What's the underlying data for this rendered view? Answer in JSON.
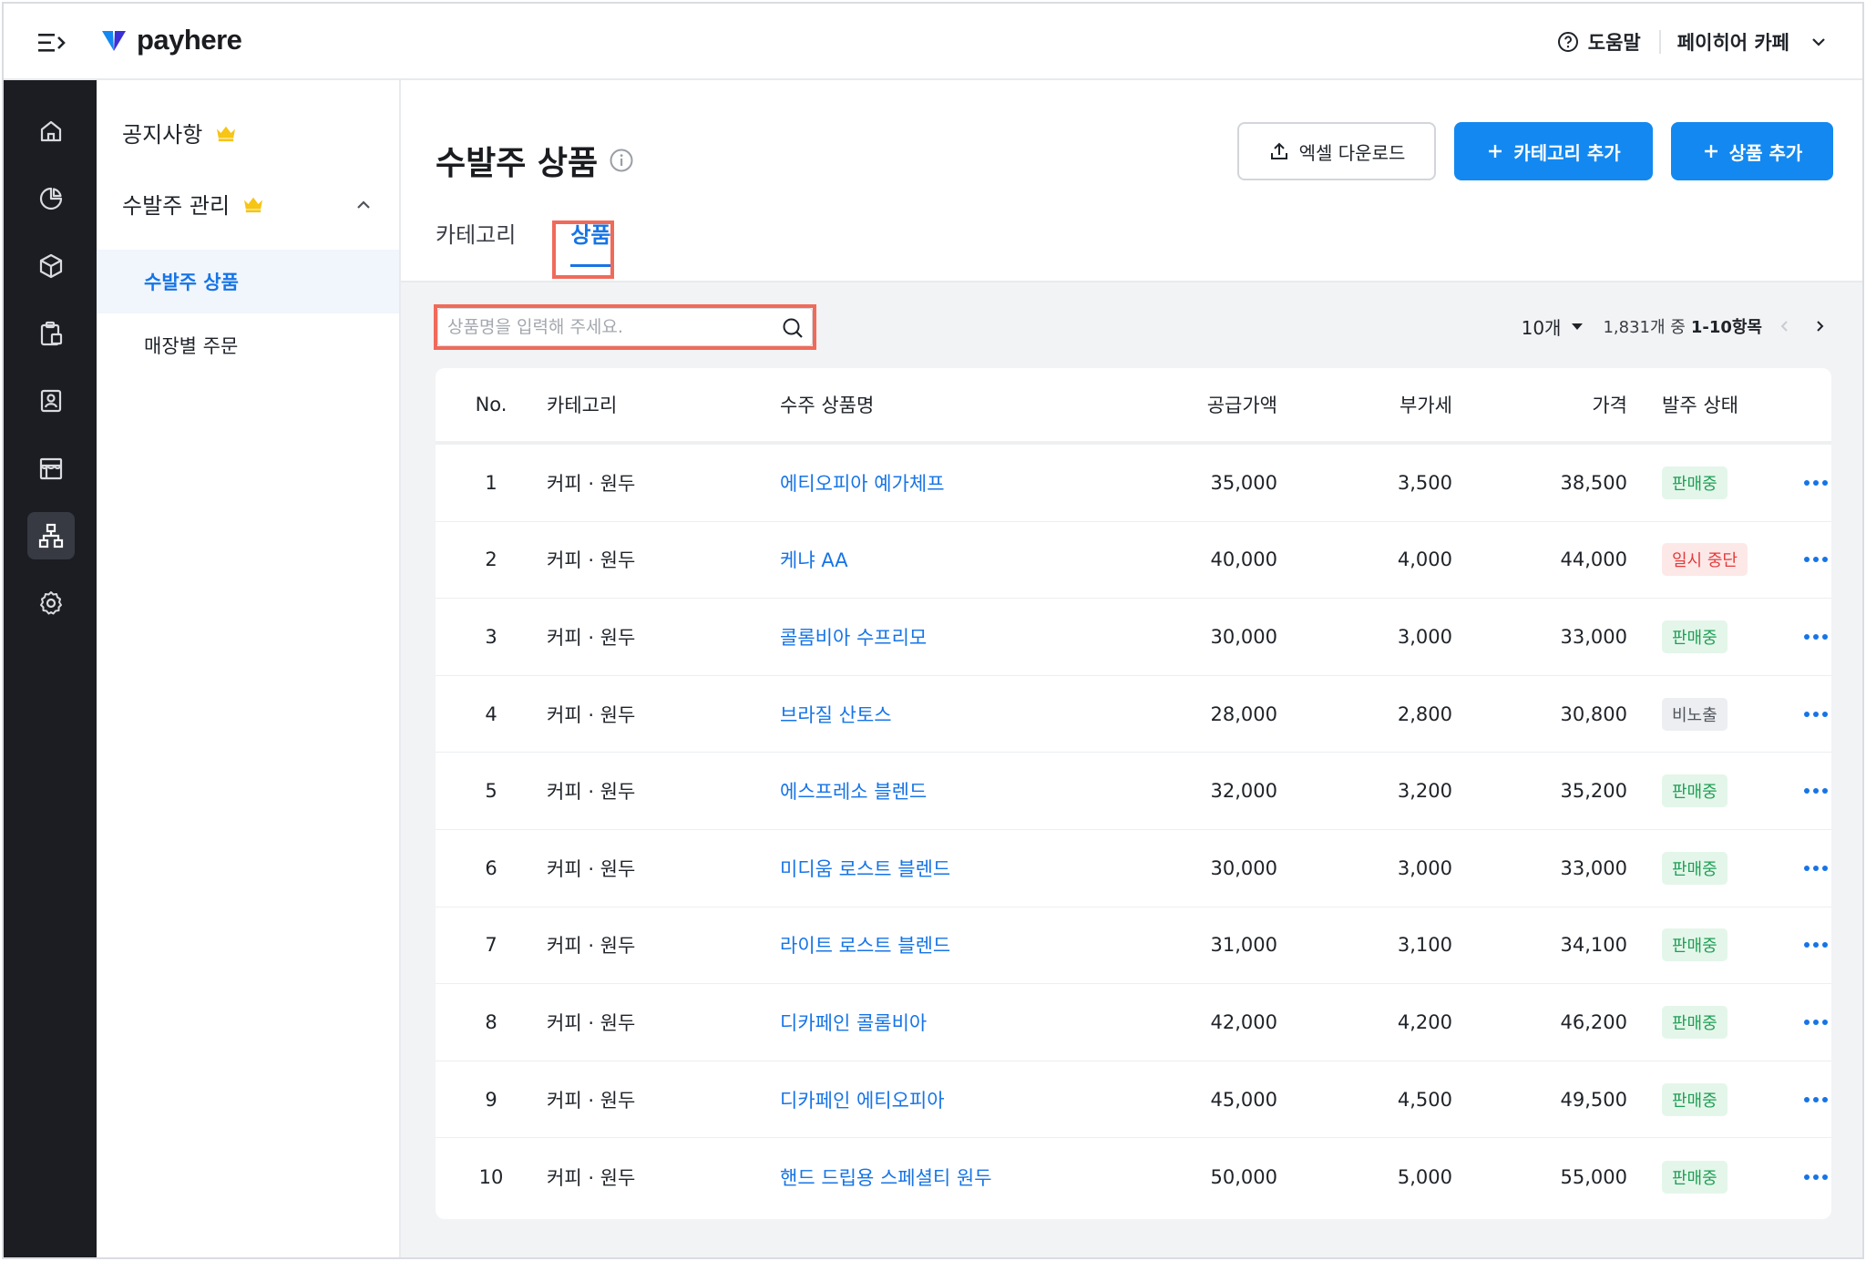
{
  "app": {
    "logo_text": "payhere",
    "brand_color": "#1388f0"
  },
  "topbar": {
    "help_label": "도움말",
    "store_label": "페이히어 카페"
  },
  "iconbar": {
    "items": [
      "home-icon",
      "chart-pie-icon",
      "box-icon",
      "clipboard-icon",
      "contact-card-icon",
      "store-icon",
      "org-chart-icon",
      "settings-icon"
    ],
    "active": "org-chart-icon"
  },
  "subnav": {
    "notice_label": "공지사항",
    "order_mgmt_label": "수발주 관리",
    "items": [
      {
        "label": "수발주 상품",
        "active": true
      },
      {
        "label": "매장별 주문",
        "active": false
      }
    ]
  },
  "page": {
    "title": "수발주 상품",
    "excel_label": "엑셀 다운로드",
    "add_category_label": "카테고리 추가",
    "add_product_label": "상품 추가",
    "tabs": [
      {
        "label": "카테고리",
        "active": false
      },
      {
        "label": "상품",
        "active": true
      }
    ]
  },
  "search": {
    "placeholder": "상품명을 입력해 주세요.",
    "value": ""
  },
  "pagination": {
    "per_page": "10개",
    "total_prefix": "1,831개 중",
    "range": "1-10항목"
  },
  "table": {
    "headers": {
      "no": "No.",
      "category": "카테고리",
      "name": "수주 상품명",
      "supply": "공급가액",
      "vat": "부가세",
      "price": "가격",
      "status": "발주 상태"
    },
    "rows": [
      {
        "no": "1",
        "category": "커피 · 원두",
        "name": "에티오피아 예가체프",
        "supply": "35,000",
        "vat": "3,500",
        "price": "38,500",
        "status": "판매중",
        "status_type": "green"
      },
      {
        "no": "2",
        "category": "커피 · 원두",
        "name": "케냐 AA",
        "supply": "40,000",
        "vat": "4,000",
        "price": "44,000",
        "status": "일시 중단",
        "status_type": "red"
      },
      {
        "no": "3",
        "category": "커피 · 원두",
        "name": "콜롬비아 수프리모",
        "supply": "30,000",
        "vat": "3,000",
        "price": "33,000",
        "status": "판매중",
        "status_type": "green"
      },
      {
        "no": "4",
        "category": "커피 · 원두",
        "name": "브라질 산토스",
        "supply": "28,000",
        "vat": "2,800",
        "price": "30,800",
        "status": "비노출",
        "status_type": "gray"
      },
      {
        "no": "5",
        "category": "커피 · 원두",
        "name": "에스프레소 블렌드",
        "supply": "32,000",
        "vat": "3,200",
        "price": "35,200",
        "status": "판매중",
        "status_type": "green"
      },
      {
        "no": "6",
        "category": "커피 · 원두",
        "name": "미디움 로스트 블렌드",
        "supply": "30,000",
        "vat": "3,000",
        "price": "33,000",
        "status": "판매중",
        "status_type": "green"
      },
      {
        "no": "7",
        "category": "커피 · 원두",
        "name": "라이트 로스트 블렌드",
        "supply": "31,000",
        "vat": "3,100",
        "price": "34,100",
        "status": "판매중",
        "status_type": "green"
      },
      {
        "no": "8",
        "category": "커피 · 원두",
        "name": "디카페인 콜롬비아",
        "supply": "42,000",
        "vat": "4,200",
        "price": "46,200",
        "status": "판매중",
        "status_type": "green"
      },
      {
        "no": "9",
        "category": "커피 · 원두",
        "name": "디카페인 에티오피아",
        "supply": "45,000",
        "vat": "4,500",
        "price": "49,500",
        "status": "판매중",
        "status_type": "green"
      },
      {
        "no": "10",
        "category": "커피 · 원두",
        "name": "핸드 드립용 스페셜티 원두",
        "supply": "50,000",
        "vat": "5,000",
        "price": "55,000",
        "status": "판매중",
        "status_type": "green"
      }
    ]
  }
}
